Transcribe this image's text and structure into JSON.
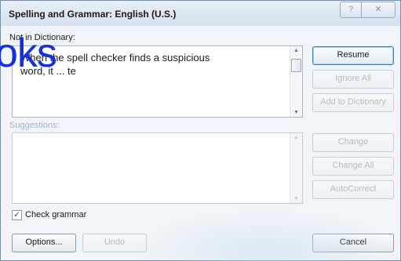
{
  "window": {
    "title": "Spelling and Grammar: English (U.S.)",
    "help_glyph": "?",
    "close_glyph": "✕"
  },
  "not_in_dictionary": {
    "label": "Not in Dictionary:",
    "text": "When the spell checker finds a suspicious word, it ... te",
    "text_line1": "When the spell checker finds a suspicious",
    "text_line2": "word, it ... te"
  },
  "suggestions": {
    "label": "Suggestions:"
  },
  "buttons": {
    "resume": "Resume",
    "ignore_all": "Ignore All",
    "add_to_dictionary": "Add to Dictionary",
    "change": "Change",
    "change_all": "Change All",
    "autocorrect": "AutoCorrect",
    "options": "Options...",
    "undo": "Undo",
    "cancel": "Cancel"
  },
  "check_grammar": {
    "label": "Check grammar",
    "checked": true,
    "mark": "✓"
  },
  "watermark": {
    "text": "oks"
  }
}
